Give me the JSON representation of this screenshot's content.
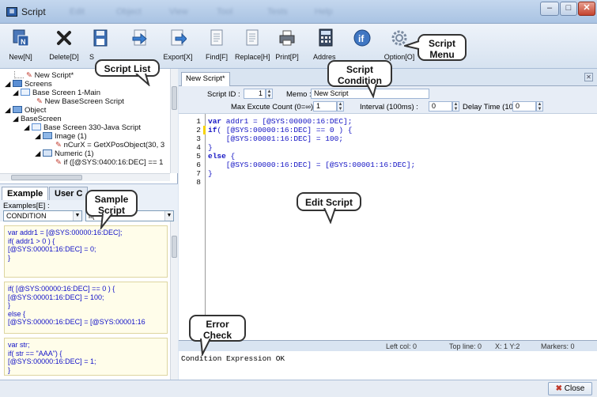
{
  "window": {
    "title": "Script",
    "blurred_menus": [
      "Edit",
      "Object",
      "View",
      "Tool",
      "Tests",
      "Help"
    ],
    "minimize_glyph": "–",
    "maximize_glyph": "□",
    "close_glyph": "✕"
  },
  "toolbar": {
    "new": "New[N]",
    "delete": "Delete[D]",
    "save": "S",
    "export": "Export[X]",
    "find": "Find[F]",
    "replace": "Replace[H]",
    "print": "Print[P]",
    "address": "Addres",
    "option": "Option[O]"
  },
  "callouts": {
    "script_list": "Script List",
    "script_menu": "Script Menu",
    "script_condition": "Script Condition",
    "sample_script": "Sample Script",
    "edit_script": "Edit Script",
    "error_check": "Error Check"
  },
  "tree": {
    "new_script": "New Script*",
    "screens": "Screens",
    "base_screen_main": "Base Screen 1-Main",
    "new_base_screen_script": "New BaseScreen Script",
    "object": "Object",
    "base_screen": "BaseScreen",
    "base_screen_java": "Base Screen 330-Java Script",
    "image": "Image (1)",
    "ncurx": "nCurX = GetXPosObject(30, 3",
    "numeric": "Numeric (1)",
    "if_sys": "if ([@SYS:0400:16:DEC] == 1"
  },
  "samples": {
    "tab_example": "Example",
    "tab_user": "User C",
    "examples_label": "Examples[E] :",
    "category": "CONDITION",
    "statement": "if(",
    "ex1": [
      "var addr1 = [@SYS:00000:16:DEC];",
      "if( addr1 > 0 ) {",
      "   [@SYS:00001:16:DEC] = 0;",
      "}"
    ],
    "ex2": [
      "if( [@SYS:00000:16:DEC] == 0 ) {",
      "   [@SYS:00001:16:DEC] = 100;",
      "}",
      "else {",
      "   [@SYS:00000:16:DEC] = [@SYS:00001:16"
    ],
    "ex3": [
      "var str;",
      "if( str == \"AAA\") {",
      "   [@SYS:00000:16:DEC] = 1;",
      "}"
    ]
  },
  "editor": {
    "doc_tab": "New Script*",
    "script_id_label": "Script ID :",
    "script_id": "1",
    "memo_label": "Memo :",
    "memo": "New Script",
    "max_label": "Max Excute Count (0=∞) :",
    "max_value": "1",
    "interval_label": "Interval (100ms) :",
    "interval_value": "0",
    "delay_label": "Delay Time (100ms) :",
    "delay_value": "0",
    "line_numbers": [
      "1",
      "2",
      "3",
      "4",
      "5",
      "6",
      "7",
      "8"
    ],
    "lines": [
      "var addr1 = [@SYS:00000:16:DEC];",
      "if( [@SYS:00000:16:DEC] == 0 ) {",
      "    [@SYS:00001:16:DEC] = 100;",
      "}",
      "else {",
      "    [@SYS:00000:16:DEC] = [@SYS:00001:16:DEC];",
      "}",
      ""
    ]
  },
  "status": {
    "left_col": "Left col: 0",
    "top_line": "Top line: 0",
    "xy": "X: 1  Y:2",
    "markers": "Markers: 0"
  },
  "error_output": "Condition Expression OK",
  "close_button": "Close"
}
